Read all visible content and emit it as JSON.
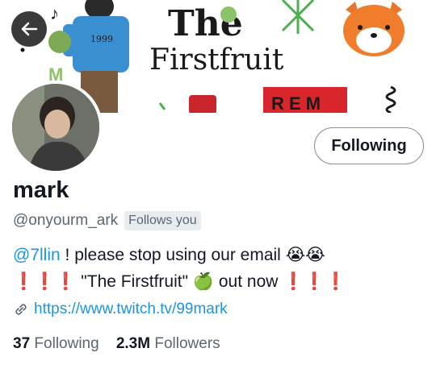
{
  "banner": {
    "title_line1": "The",
    "title_line2": "Firstfruit",
    "shirt_text": "1999",
    "letter_m": "M",
    "poster_text": "R E M"
  },
  "profile": {
    "name": "mark",
    "handle": "@onyourm_ark",
    "follows_you": "Follows you",
    "follow_button": "Following"
  },
  "bio": {
    "mention": "@7llin",
    "line1_text": " ! please stop using our email ",
    "cry_emoji": "😭😭",
    "excl_left": "❗❗❗",
    "line2_text": " \"The Firstfruit\" ",
    "apple_emoji": "🍏",
    "line2_text_b": " out now ",
    "excl_right": "❗❗❗"
  },
  "link": {
    "url": "https://www.twitch.tv/99mark"
  },
  "stats": {
    "following_count": "37",
    "following_label": "Following",
    "followers_count": "2.3M",
    "followers_label": "Followers"
  }
}
